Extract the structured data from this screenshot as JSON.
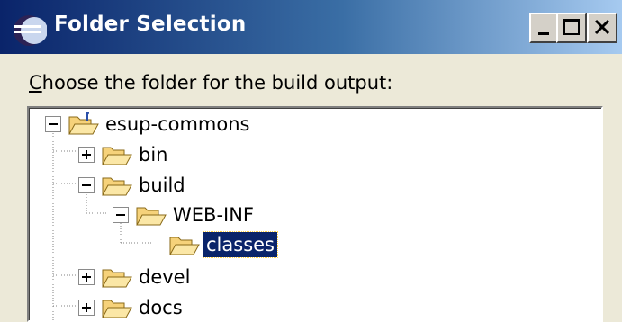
{
  "window": {
    "title": "Folder Selection",
    "title_bar_colors": [
      "#0a246a",
      "#a6caf0"
    ]
  },
  "title_buttons": [
    {
      "name": "minimize",
      "icon": "minimize-icon"
    },
    {
      "name": "maximize",
      "icon": "maximize-icon"
    },
    {
      "name": "close",
      "icon": "close-icon"
    }
  ],
  "prompt": {
    "mnemonic": "C",
    "rest": "hoose the folder for the build output:"
  },
  "tree": {
    "selection_color": "#0a246a",
    "nodes": [
      {
        "label": "esup-commons",
        "level": 0,
        "state": "expanded",
        "icon": "project-folder-icon",
        "selected": false
      },
      {
        "label": "bin",
        "level": 1,
        "state": "collapsed",
        "icon": "folder-icon",
        "selected": false
      },
      {
        "label": "build",
        "level": 1,
        "state": "expanded",
        "icon": "folder-icon",
        "selected": false
      },
      {
        "label": "WEB-INF",
        "level": 2,
        "state": "expanded",
        "icon": "folder-icon",
        "selected": false
      },
      {
        "label": "classes",
        "level": 3,
        "state": "leaf",
        "icon": "open-folder-icon",
        "selected": true
      },
      {
        "label": "devel",
        "level": 1,
        "state": "collapsed",
        "icon": "folder-icon",
        "selected": false
      },
      {
        "label": "docs",
        "level": 1,
        "state": "collapsed",
        "icon": "folder-icon",
        "selected": false
      }
    ]
  }
}
